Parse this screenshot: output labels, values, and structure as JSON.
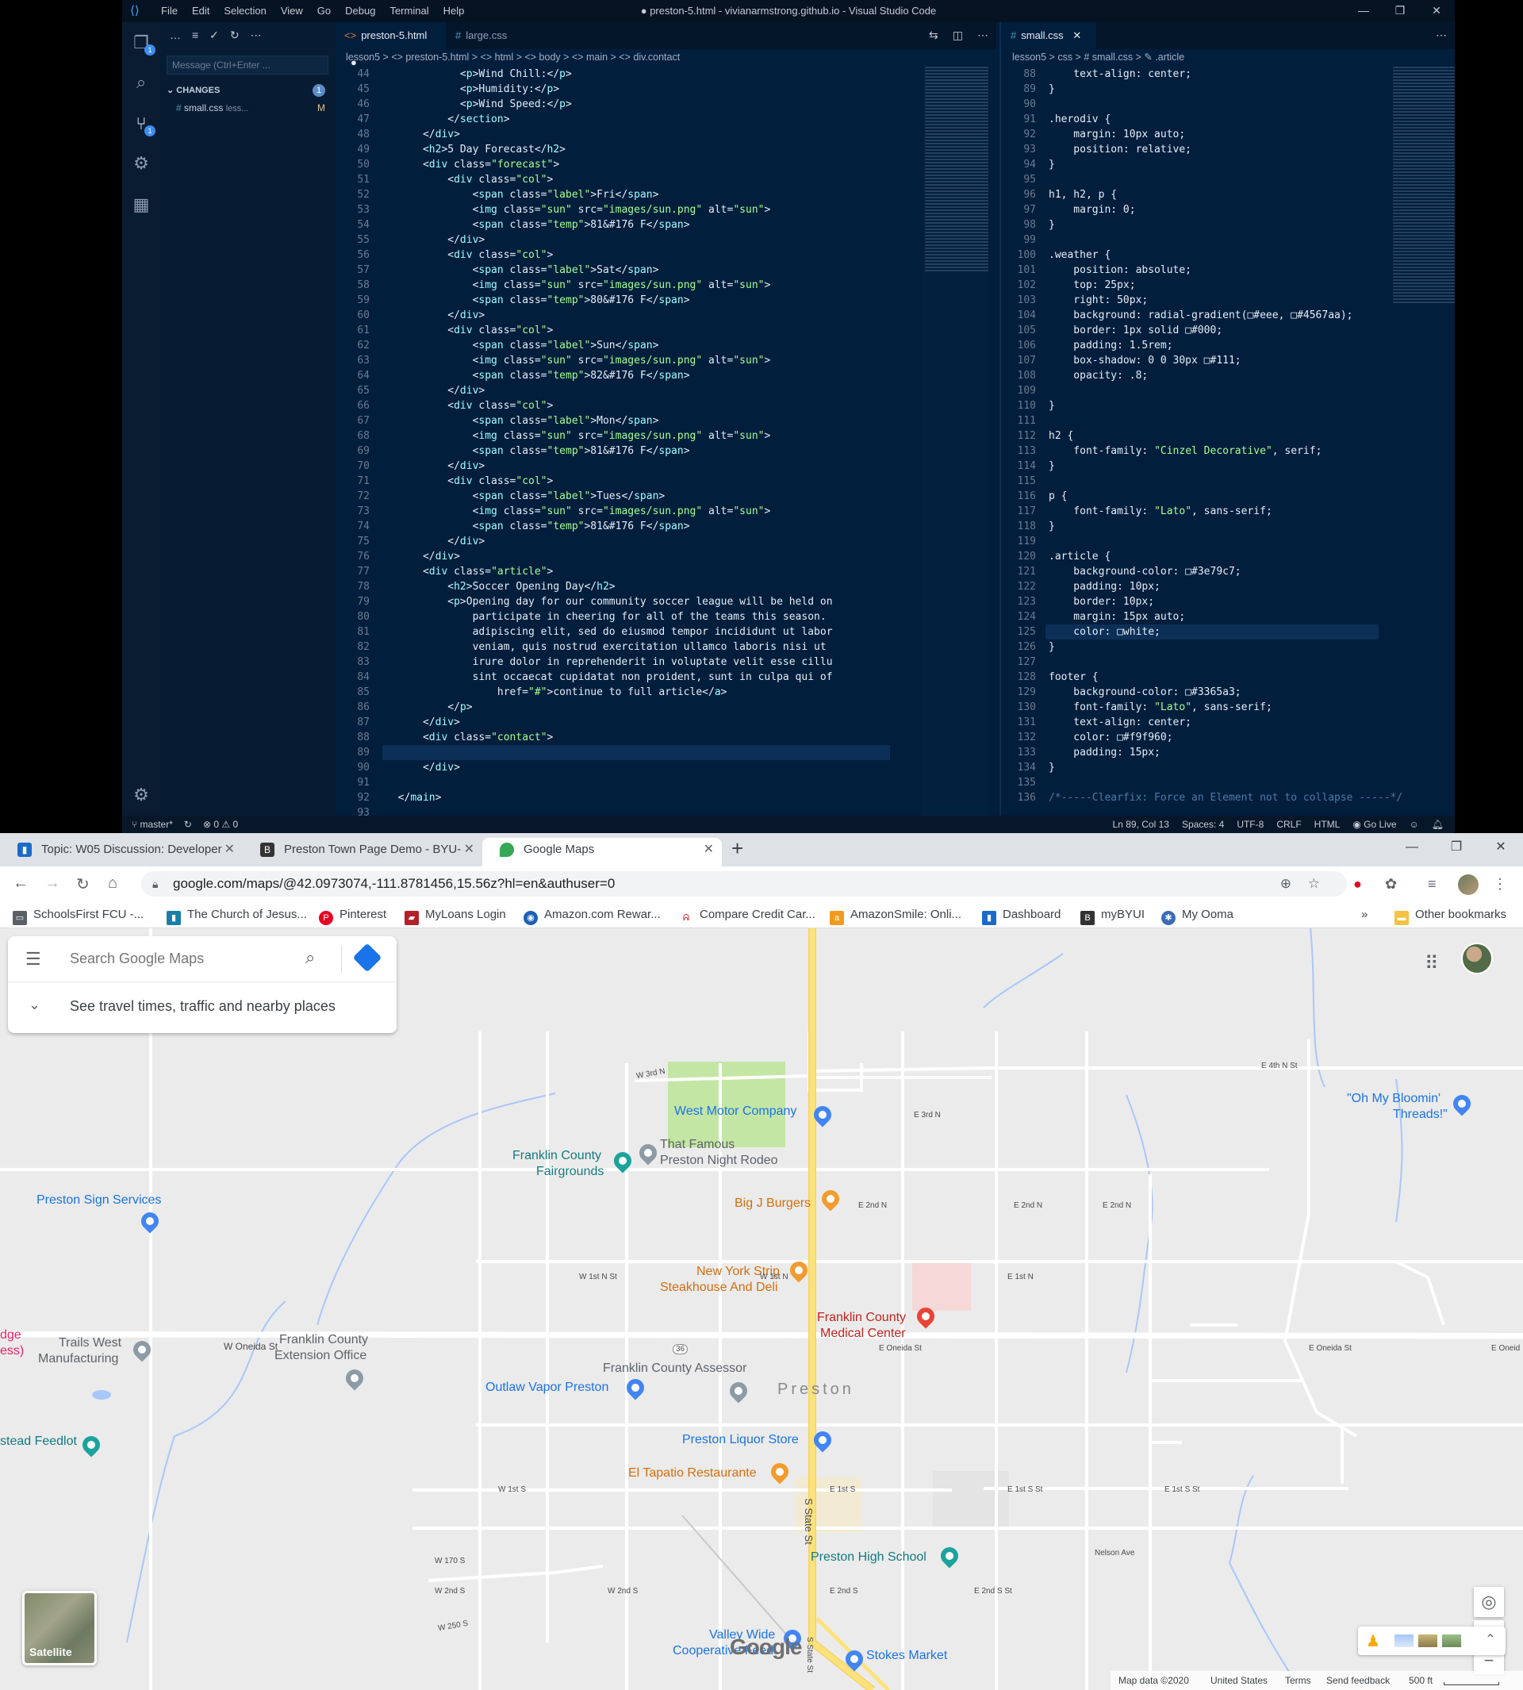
{
  "vscode": {
    "window_title": "● preston-5.html - vivianarmstrong.github.io - Visual Studio Code",
    "menus": [
      "File",
      "Edit",
      "Selection",
      "View",
      "Go",
      "Debug",
      "Terminal",
      "Help"
    ],
    "window_controls": [
      "—",
      "❐",
      "✕"
    ],
    "scm": {
      "message_placeholder": "Message (Ctrl+Enter ...",
      "changes_label": "CHANGES",
      "changes_count": "1",
      "file_name": "small.css",
      "file_path": "less...",
      "file_status": "M"
    },
    "editor_left": {
      "tabs": [
        "preston-5.html",
        "large.css"
      ],
      "breadcrumb": "lesson5  >  <> preston-5.html  >  <> html  >  <> body  >  <> main  >  <> div.contact",
      "lines": [
        {
          "n": "44",
          "t": "            <p>Wind Chill:</p>"
        },
        {
          "n": "45",
          "t": "            <p>Humidity:</p>"
        },
        {
          "n": "46",
          "t": "            <p>Wind Speed:</p>"
        },
        {
          "n": "47",
          "t": "          </section>"
        },
        {
          "n": "48",
          "t": "      </div>"
        },
        {
          "n": "49",
          "t": "      <h2>5 Day Forecast</h2>"
        },
        {
          "n": "50",
          "t": "      <div class=\"forecast\">"
        },
        {
          "n": "51",
          "t": "          <div class=\"col\">"
        },
        {
          "n": "52",
          "t": "              <span class=\"label\">Fri</span>"
        },
        {
          "n": "53",
          "t": "              <img class=\"sun\" src=\"images/sun.png\" alt=\"sun\">"
        },
        {
          "n": "54",
          "t": "              <span class=\"temp\">81&#176 F</span>"
        },
        {
          "n": "55",
          "t": "          </div>"
        },
        {
          "n": "56",
          "t": "          <div class=\"col\">"
        },
        {
          "n": "57",
          "t": "              <span class=\"label\">Sat</span>"
        },
        {
          "n": "58",
          "t": "              <img class=\"sun\" src=\"images/sun.png\" alt=\"sun\">"
        },
        {
          "n": "59",
          "t": "              <span class=\"temp\">80&#176 F</span>"
        },
        {
          "n": "60",
          "t": "          </div>"
        },
        {
          "n": "61",
          "t": "          <div class=\"col\">"
        },
        {
          "n": "62",
          "t": "              <span class=\"label\">Sun</span>"
        },
        {
          "n": "63",
          "t": "              <img class=\"sun\" src=\"images/sun.png\" alt=\"sun\">"
        },
        {
          "n": "64",
          "t": "              <span class=\"temp\">82&#176 F</span>"
        },
        {
          "n": "65",
          "t": "          </div>"
        },
        {
          "n": "66",
          "t": "          <div class=\"col\">"
        },
        {
          "n": "67",
          "t": "              <span class=\"label\">Mon</span>"
        },
        {
          "n": "68",
          "t": "              <img class=\"sun\" src=\"images/sun.png\" alt=\"sun\">"
        },
        {
          "n": "69",
          "t": "              <span class=\"temp\">81&#176 F</span>"
        },
        {
          "n": "70",
          "t": "          </div>"
        },
        {
          "n": "71",
          "t": "          <div class=\"col\">"
        },
        {
          "n": "72",
          "t": "              <span class=\"label\">Tues</span>"
        },
        {
          "n": "73",
          "t": "              <img class=\"sun\" src=\"images/sun.png\" alt=\"sun\">"
        },
        {
          "n": "74",
          "t": "              <span class=\"temp\">81&#176 F</span>"
        },
        {
          "n": "75",
          "t": "          </div>"
        },
        {
          "n": "76",
          "t": "      </div>"
        },
        {
          "n": "77",
          "t": "      <div class=\"article\">"
        },
        {
          "n": "78",
          "t": "          <h2>Soccer Opening Day</h2>"
        },
        {
          "n": "79",
          "t": "          <p>Opening day for our community soccer league will be held on"
        },
        {
          "n": "80",
          "t": "              participate in cheering for all of the teams this season."
        },
        {
          "n": "81",
          "t": "              adipiscing elit, sed do eiusmod tempor incididunt ut labor"
        },
        {
          "n": "82",
          "t": "              veniam, quis nostrud exercitation ullamco laboris nisi ut"
        },
        {
          "n": "83",
          "t": "              irure dolor in reprehenderit in voluptate velit esse cillu"
        },
        {
          "n": "84",
          "t": "              sint occaecat cupidatat non proident, sunt in culpa qui of"
        },
        {
          "n": "85",
          "t": "                  href=\"#\">continue to full article</a>"
        },
        {
          "n": "86",
          "t": "          </p>"
        },
        {
          "n": "87",
          "t": "      </div>"
        },
        {
          "n": "88",
          "t": "      <div class=\"contact\">"
        },
        {
          "n": "89",
          "t": ""
        },
        {
          "n": "90",
          "t": "      </div>"
        },
        {
          "n": "91",
          "t": ""
        },
        {
          "n": "92",
          "t": "  </main>"
        },
        {
          "n": "93",
          "t": ""
        }
      ]
    },
    "editor_right": {
      "tab": "small.css",
      "breadcrumb": "lesson5  >  css  >  # small.css  >  ✎ .article",
      "lines": [
        {
          "n": "88",
          "t": "    text-align: center;"
        },
        {
          "n": "89",
          "t": "}"
        },
        {
          "n": "90",
          "t": ""
        },
        {
          "n": "91",
          "t": ".herodiv {"
        },
        {
          "n": "92",
          "t": "    margin: 10px auto;"
        },
        {
          "n": "93",
          "t": "    position: relative;"
        },
        {
          "n": "94",
          "t": "}"
        },
        {
          "n": "95",
          "t": ""
        },
        {
          "n": "96",
          "t": "h1, h2, p {"
        },
        {
          "n": "97",
          "t": "    margin: 0;"
        },
        {
          "n": "98",
          "t": "}"
        },
        {
          "n": "99",
          "t": ""
        },
        {
          "n": "100",
          "t": ".weather {"
        },
        {
          "n": "101",
          "t": "    position: absolute;"
        },
        {
          "n": "102",
          "t": "    top: 25px;"
        },
        {
          "n": "103",
          "t": "    right: 50px;"
        },
        {
          "n": "104",
          "t": "    background: radial-gradient(□#eee, □#4567aa);"
        },
        {
          "n": "105",
          "t": "    border: 1px solid □#000;"
        },
        {
          "n": "106",
          "t": "    padding: 1.5rem;"
        },
        {
          "n": "107",
          "t": "    box-shadow: 0 0 30px □#111;"
        },
        {
          "n": "108",
          "t": "    opacity: .8;"
        },
        {
          "n": "109",
          "t": ""
        },
        {
          "n": "110",
          "t": "}"
        },
        {
          "n": "111",
          "t": ""
        },
        {
          "n": "112",
          "t": "h2 {"
        },
        {
          "n": "113",
          "t": "    font-family: \"Cinzel Decorative\", serif;"
        },
        {
          "n": "114",
          "t": "}"
        },
        {
          "n": "115",
          "t": ""
        },
        {
          "n": "116",
          "t": "p {"
        },
        {
          "n": "117",
          "t": "    font-family: \"Lato\", sans-serif;"
        },
        {
          "n": "118",
          "t": "}"
        },
        {
          "n": "119",
          "t": ""
        },
        {
          "n": "120",
          "t": ".article {"
        },
        {
          "n": "121",
          "t": "    background-color: □#3e79c7;"
        },
        {
          "n": "122",
          "t": "    padding: 10px;"
        },
        {
          "n": "123",
          "t": "    border: 10px;"
        },
        {
          "n": "124",
          "t": "    margin: 15px auto;"
        },
        {
          "n": "125",
          "t": "    color: □white;"
        },
        {
          "n": "126",
          "t": "}"
        },
        {
          "n": "127",
          "t": ""
        },
        {
          "n": "128",
          "t": "footer {"
        },
        {
          "n": "129",
          "t": "    background-color: □#3365a3;"
        },
        {
          "n": "130",
          "t": "    font-family: \"Lato\", sans-serif;"
        },
        {
          "n": "131",
          "t": "    text-align: center;"
        },
        {
          "n": "132",
          "t": "    color: □#f9f960;"
        },
        {
          "n": "133",
          "t": "    padding: 15px;"
        },
        {
          "n": "134",
          "t": "}"
        },
        {
          "n": "135",
          "t": ""
        },
        {
          "n": "136",
          "t": "/*-----Clearfix: Force an Element not to collapse -----*/"
        }
      ]
    },
    "status": {
      "branch": "master*",
      "problems": "⊗ 0 ⚠ 0",
      "position": "Ln 89, Col 13",
      "spaces": "Spaces: 4",
      "encoding": "UTF-8",
      "eol": "CRLF",
      "language": "HTML",
      "golive": "Go Live"
    }
  },
  "chrome": {
    "tabs": [
      {
        "title": "Topic: W05 Discussion: Developer",
        "icon": "chart-icon"
      },
      {
        "title": "Preston Town Page Demo - BYU-",
        "icon": "byui-icon"
      },
      {
        "title": "Google Maps",
        "icon": "maps-pin-icon"
      }
    ],
    "url": "google.com/maps/@42.0973074,-111.8781456,15.56z?hl=en&authuser=0",
    "bookmarks": [
      "SchoolsFirst FCU -...",
      "The Church of Jesus...",
      "Pinterest",
      "MyLoans Login",
      "Amazon.com Rewar...",
      "Compare Credit Car...",
      "AmazonSmile: Onli...",
      "Dashboard",
      "myBYUI",
      "My Ooma"
    ],
    "other_bookmarks": "Other bookmarks",
    "overflow": "»"
  },
  "maps": {
    "search_placeholder": "Search Google Maps",
    "travel_hint": "See travel times, traffic and nearby places",
    "satellite_label": "Satellite",
    "brand": "Google",
    "attribution": [
      "Map data ©2020",
      "United States",
      "Terms",
      "Send feedback",
      "500 ft"
    ],
    "places": {
      "west_motor": "West Motor Company",
      "oh_my_bloomin_1": "\"Oh My Bloomin'",
      "oh_my_bloomin_2": "Threads!\"",
      "franklin_fair_1": "Franklin County",
      "franklin_fair_2": "Fairgrounds",
      "rodeo_1": "That Famous",
      "rodeo_2": "Preston Night Rodeo",
      "preston_sign": "Preston Sign Services",
      "big_j": "Big J Burgers",
      "ny_strip_1": "New York Strip",
      "ny_strip_2": "Steakhouse And Deli",
      "med_1": "Franklin County",
      "med_2": "Medical Center",
      "trails_1": "Trails West",
      "trails_2": "Manufacturing",
      "ext_1": "Franklin County",
      "ext_2": "Extension Office",
      "assessor": "Franklin County Assessor",
      "outlaw": "Outlaw Vapor Preston",
      "preston": "Preston",
      "edge_1": "dge",
      "edge_2": "ess)",
      "feedlot": "stead Feedlot",
      "liquor": "Preston Liquor Store",
      "tapatio": "El Tapatio Restaurante",
      "high_school": "Preston High School",
      "valley_1": "Valley Wide",
      "valley_2": "Cooperative Feed",
      "stokes": "Stokes Market"
    },
    "streets": {
      "e4th": "E 4th N St",
      "w3rd": "W 3rd N",
      "e3rd": "E 3rd N",
      "e2nd_a": "E 2nd N",
      "e2nd_b": "E 2nd N",
      "e2nd_c": "E 2nd N",
      "w1st": "W 1st N St",
      "w1stn": "W 1st N",
      "e1stn": "E 1st N",
      "w_oneida": "W Oneida St",
      "e_oneida_a": "E Oneida St",
      "e_oneida_b": "E Oneida St",
      "e_oneida_c": "E Oneid",
      "hwy36": "36",
      "w1sts": "W 1st S",
      "e1sts": "E 1st S",
      "e1stsst": "E 1st S St",
      "e1stsst2": "E 1st S St",
      "nelson": "Nelson Ave",
      "w170": "W 170 S",
      "w2nd_a": "W 2nd S",
      "w2nd_b": "W 2nd S",
      "e2nds": "E 2nd S",
      "e2ndsst": "E 2nd S St",
      "w250": "W 250 S",
      "s_state": "S State St",
      "s_state2": "S State St"
    }
  },
  "colors": {
    "vscode_bg": "#011e3d",
    "maps_blue": "#1a73e8",
    "road_yellow": "#fce27b",
    "park_green": "#c3e6a4"
  }
}
